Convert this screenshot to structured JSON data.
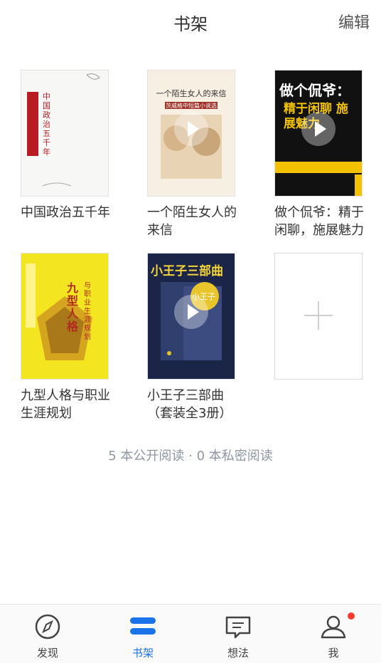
{
  "header": {
    "title": "书架",
    "edit_label": "编辑"
  },
  "books": [
    {
      "title": "中国政治五千年",
      "cover_text": "中国政治五千年"
    },
    {
      "title": "一个陌生女人的来信",
      "cover_text": "一个陌生女人的来信",
      "cover_subtitle": "茨威格中短篇小说选"
    },
    {
      "title": "做个侃爷：精于闲聊，施展魅力",
      "cover_text": "做个侃爷：",
      "cover_subtitle": "精于闲聊 施展魅力"
    },
    {
      "title": "九型人格与职业生涯规划",
      "cover_text": "九型人格",
      "cover_subtitle": "与职业生涯规划"
    },
    {
      "title": "小王子三部曲（套装全3册）",
      "cover_text": "小王子三部曲",
      "cover_subtitle": "小王子"
    }
  ],
  "summary": "5 本公开阅读 · 0 本私密阅读",
  "tabs": [
    {
      "label": "发现",
      "icon": "compass-icon"
    },
    {
      "label": "书架",
      "icon": "bookshelf-icon"
    },
    {
      "label": "想法",
      "icon": "message-icon"
    },
    {
      "label": "我",
      "icon": "profile-icon"
    }
  ],
  "colors": {
    "accent": "#1a73e8",
    "badge": "#ff3b30",
    "summary": "#8f96a3"
  }
}
